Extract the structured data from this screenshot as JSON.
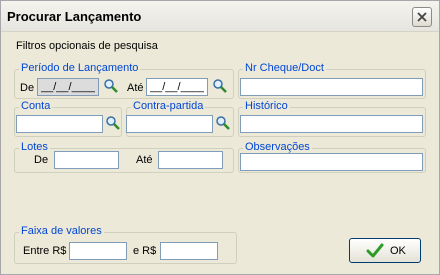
{
  "window": {
    "title": "Procurar Lançamento"
  },
  "filters": {
    "caption": "Filtros opcionais de pesquisa",
    "periodo": {
      "legend": "Período de Lançamento",
      "de_label": "De",
      "ate_label": "Até",
      "de_value": "__/__/____",
      "ate_value": "__/__/____"
    },
    "cheque": {
      "legend": "Nr Cheque/Doct",
      "value": ""
    },
    "conta": {
      "legend": "Conta",
      "value": ""
    },
    "contrapartida": {
      "legend": "Contra-partida",
      "value": ""
    },
    "historico": {
      "legend": "Histórico",
      "value": ""
    },
    "lotes": {
      "legend": "Lotes",
      "de_label": "De",
      "ate_label": "Até",
      "de_value": "",
      "ate_value": ""
    },
    "observacoes": {
      "legend": "Observações",
      "value": ""
    },
    "faixa": {
      "legend": "Faixa de valores",
      "entre_label": "Entre R$",
      "e_label": "e R$",
      "min_value": "",
      "max_value": ""
    }
  },
  "buttons": {
    "ok_label": "OK"
  },
  "colors": {
    "legend": "#0046d5",
    "ok_check": "#2e9b26"
  }
}
